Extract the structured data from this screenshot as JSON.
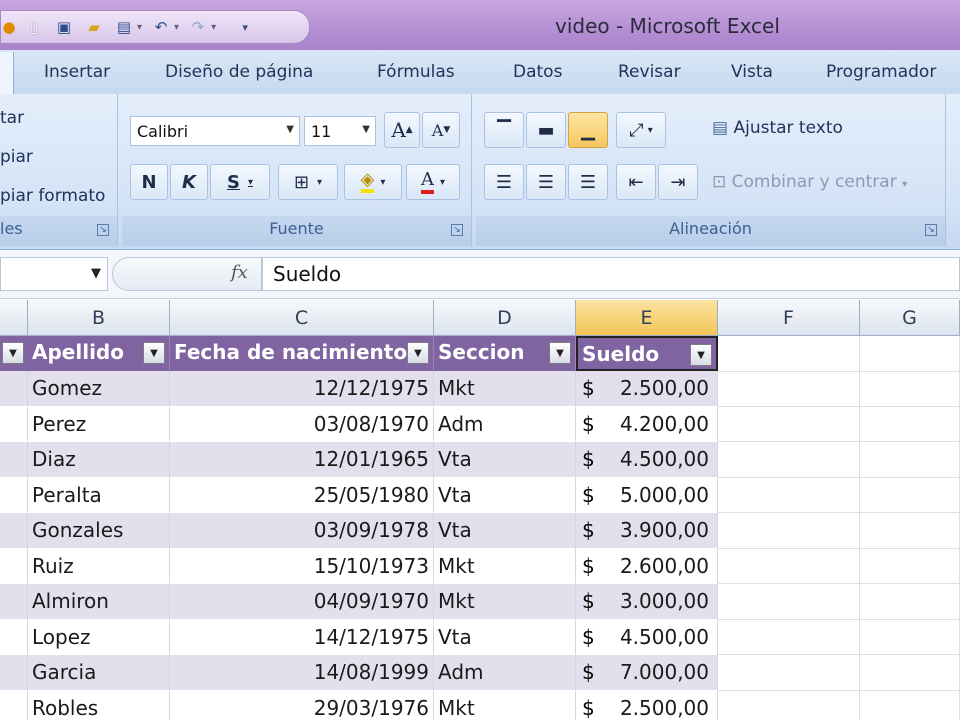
{
  "window": {
    "title": "video - Microsoft Excel"
  },
  "qat": {
    "icons": [
      "office-icon",
      "new-icon",
      "save-icon",
      "open-icon",
      "print-icon",
      "undo-icon",
      "redo-icon",
      "customize-icon"
    ]
  },
  "tabs": [
    "Insertar",
    "Diseño de página",
    "Fórmulas",
    "Datos",
    "Revisar",
    "Vista",
    "Programador"
  ],
  "clipboard": {
    "items": [
      "tar",
      "piar",
      "piar formato"
    ],
    "label": "les"
  },
  "font": {
    "name": "Calibri",
    "size": "11",
    "grow": "A",
    "shrink": "A",
    "bold": "N",
    "italic": "K",
    "underline": "S",
    "label": "Fuente"
  },
  "alignment": {
    "wrap": "Ajustar texto",
    "merge": "Combinar y centrar",
    "label": "Alineación"
  },
  "formula": {
    "content": "Sueldo",
    "fx": "fx"
  },
  "columns": [
    "B",
    "C",
    "D",
    "E",
    "F",
    "G"
  ],
  "table": {
    "headers": [
      "Apellido",
      "Fecha de nacimiento",
      "Seccion",
      "Sueldo"
    ],
    "currency": "$",
    "rows": [
      [
        "Gomez",
        "12/12/1975",
        "Mkt",
        "2.500,00"
      ],
      [
        "Perez",
        "03/08/1970",
        "Adm",
        "4.200,00"
      ],
      [
        "Diaz",
        "12/01/1965",
        "Vta",
        "4.500,00"
      ],
      [
        "Peralta",
        "25/05/1980",
        "Vta",
        "5.000,00"
      ],
      [
        "Gonzales",
        "03/09/1978",
        "Vta",
        "3.900,00"
      ],
      [
        "Ruiz",
        "15/10/1973",
        "Mkt",
        "2.600,00"
      ],
      [
        "Almiron",
        "04/09/1970",
        "Mkt",
        "3.000,00"
      ],
      [
        "Lopez",
        "14/12/1975",
        "Vta",
        "4.500,00"
      ],
      [
        "Garcia",
        "14/08/1999",
        "Adm",
        "7.000,00"
      ],
      [
        "Robles",
        "29/03/1976",
        "Mkt",
        "2.500,00"
      ]
    ]
  },
  "colors": {
    "table_header": "#8064a2",
    "band": "#e4dfec",
    "selected_col": "#f3c557"
  }
}
